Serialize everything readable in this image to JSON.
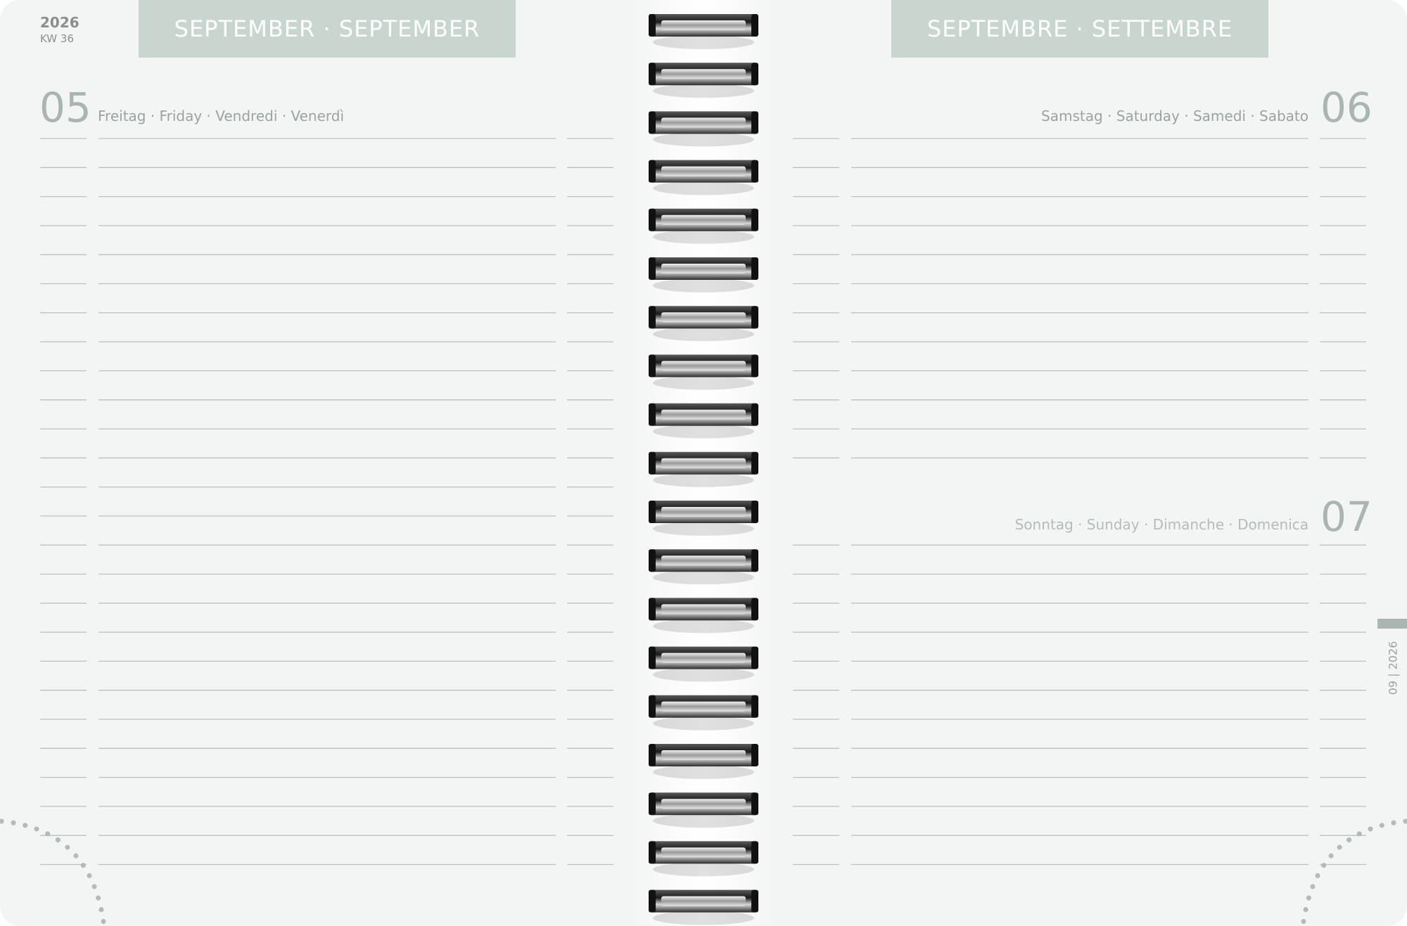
{
  "left_page": {
    "year": "2026",
    "week": "KW 36",
    "month_tab": "SEPTEMBER · SEPTEMBER",
    "day": {
      "number": "05",
      "names": "Freitag · Friday · Vendredi · Venerdì"
    }
  },
  "right_page": {
    "month_tab": "SEPTEMBRE · SETTEMBRE",
    "days": [
      {
        "number": "06",
        "names": "Samstag · Saturday · Samedi · Sabato"
      },
      {
        "number": "07",
        "names": "Sonntag · Sunday · Dimanche · Domenica"
      }
    ],
    "edge_label": "09 | 2026"
  },
  "colors": {
    "paper": "#f3f5f4",
    "tab": "#c9d6d0",
    "rule": "#b8c2bd",
    "accent_text": "#9aa39f",
    "ring": "#2b2b2b"
  }
}
